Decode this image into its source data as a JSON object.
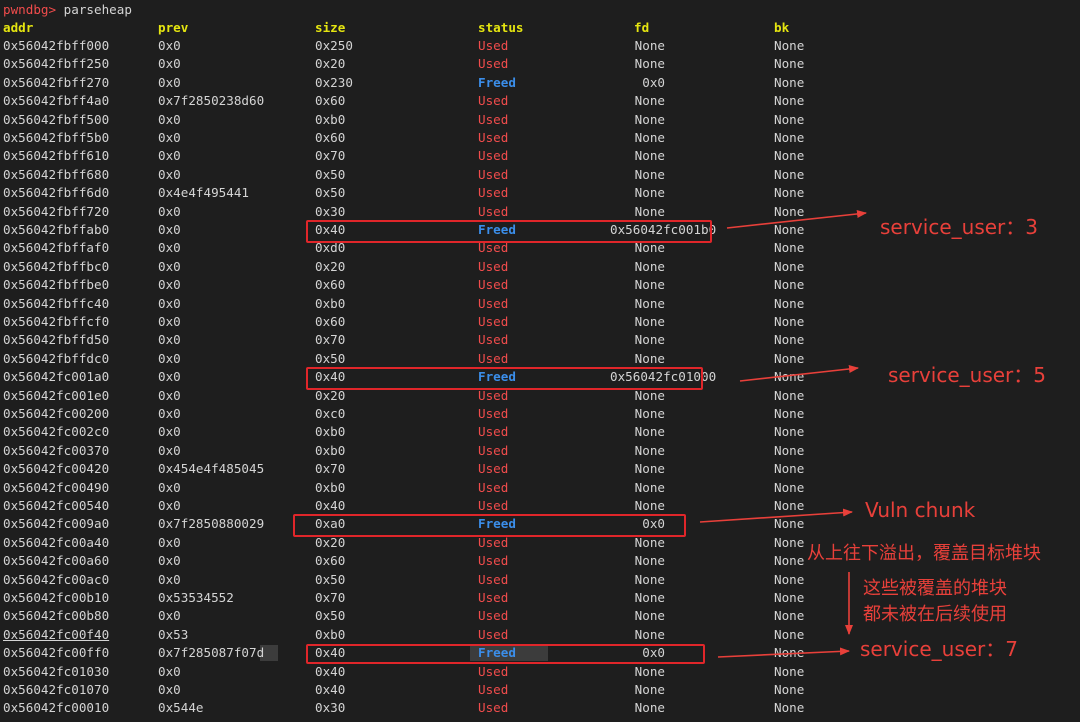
{
  "terminal": {
    "prompt": "pwndbg>",
    "command": "parseheap"
  },
  "table": {
    "headers": [
      "addr",
      "prev",
      "size",
      "status",
      "fd",
      "bk"
    ],
    "rows": [
      {
        "addr": "0x56042fbff000",
        "prev": "0x0",
        "size": "0x250",
        "status": "Used",
        "fd": "None",
        "bk": "None"
      },
      {
        "addr": "0x56042fbff250",
        "prev": "0x0",
        "size": "0x20",
        "status": "Used",
        "fd": "None",
        "bk": "None"
      },
      {
        "addr": "0x56042fbff270",
        "prev": "0x0",
        "size": "0x230",
        "status": "Freed",
        "fd": "0x0",
        "bk": "None"
      },
      {
        "addr": "0x56042fbff4a0",
        "prev": "0x7f2850238d60",
        "size": "0x60",
        "status": "Used",
        "fd": "None",
        "bk": "None"
      },
      {
        "addr": "0x56042fbff500",
        "prev": "0x0",
        "size": "0xb0",
        "status": "Used",
        "fd": "None",
        "bk": "None"
      },
      {
        "addr": "0x56042fbff5b0",
        "prev": "0x0",
        "size": "0x60",
        "status": "Used",
        "fd": "None",
        "bk": "None"
      },
      {
        "addr": "0x56042fbff610",
        "prev": "0x0",
        "size": "0x70",
        "status": "Used",
        "fd": "None",
        "bk": "None"
      },
      {
        "addr": "0x56042fbff680",
        "prev": "0x0",
        "size": "0x50",
        "status": "Used",
        "fd": "None",
        "bk": "None"
      },
      {
        "addr": "0x56042fbff6d0",
        "prev": "0x4e4f495441",
        "size": "0x50",
        "status": "Used",
        "fd": "None",
        "bk": "None"
      },
      {
        "addr": "0x56042fbff720",
        "prev": "0x0",
        "size": "0x30",
        "status": "Used",
        "fd": "None",
        "bk": "None"
      },
      {
        "addr": "0x56042fbffab0",
        "prev": "0x0",
        "size": "0x40",
        "status": "Freed",
        "fd": "0x56042fc001b0",
        "bk": "None"
      },
      {
        "addr": "0x56042fbffaf0",
        "prev": "0x0",
        "size": "0xd0",
        "status": "Used",
        "fd": "None",
        "bk": "None"
      },
      {
        "addr": "0x56042fbffbc0",
        "prev": "0x0",
        "size": "0x20",
        "status": "Used",
        "fd": "None",
        "bk": "None"
      },
      {
        "addr": "0x56042fbffbe0",
        "prev": "0x0",
        "size": "0x60",
        "status": "Used",
        "fd": "None",
        "bk": "None"
      },
      {
        "addr": "0x56042fbffc40",
        "prev": "0x0",
        "size": "0xb0",
        "status": "Used",
        "fd": "None",
        "bk": "None"
      },
      {
        "addr": "0x56042fbffcf0",
        "prev": "0x0",
        "size": "0x60",
        "status": "Used",
        "fd": "None",
        "bk": "None"
      },
      {
        "addr": "0x56042fbffd50",
        "prev": "0x0",
        "size": "0x70",
        "status": "Used",
        "fd": "None",
        "bk": "None"
      },
      {
        "addr": "0x56042fbffdc0",
        "prev": "0x0",
        "size": "0x50",
        "status": "Used",
        "fd": "None",
        "bk": "None"
      },
      {
        "addr": "0x56042fc001a0",
        "prev": "0x0",
        "size": "0x40",
        "status": "Freed",
        "fd": "0x56042fc01000",
        "bk": "None"
      },
      {
        "addr": "0x56042fc001e0",
        "prev": "0x0",
        "size": "0x20",
        "status": "Used",
        "fd": "None",
        "bk": "None"
      },
      {
        "addr": "0x56042fc00200",
        "prev": "0x0",
        "size": "0xc0",
        "status": "Used",
        "fd": "None",
        "bk": "None"
      },
      {
        "addr": "0x56042fc002c0",
        "prev": "0x0",
        "size": "0xb0",
        "status": "Used",
        "fd": "None",
        "bk": "None"
      },
      {
        "addr": "0x56042fc00370",
        "prev": "0x0",
        "size": "0xb0",
        "status": "Used",
        "fd": "None",
        "bk": "None"
      },
      {
        "addr": "0x56042fc00420",
        "prev": "0x454e4f485045",
        "size": "0x70",
        "status": "Used",
        "fd": "None",
        "bk": "None"
      },
      {
        "addr": "0x56042fc00490",
        "prev": "0x0",
        "size": "0xb0",
        "status": "Used",
        "fd": "None",
        "bk": "None"
      },
      {
        "addr": "0x56042fc00540",
        "prev": "0x0",
        "size": "0x40",
        "status": "Used",
        "fd": "None",
        "bk": "None"
      },
      {
        "addr": "0x56042fc009a0",
        "prev": "0x7f2850880029",
        "size": "0xa0",
        "status": "Freed",
        "fd": "0x0",
        "bk": "None"
      },
      {
        "addr": "0x56042fc00a40",
        "prev": "0x0",
        "size": "0x20",
        "status": "Used",
        "fd": "None",
        "bk": "None"
      },
      {
        "addr": "0x56042fc00a60",
        "prev": "0x0",
        "size": "0x60",
        "status": "Used",
        "fd": "None",
        "bk": "None"
      },
      {
        "addr": "0x56042fc00ac0",
        "prev": "0x0",
        "size": "0x50",
        "status": "Used",
        "fd": "None",
        "bk": "None"
      },
      {
        "addr": "0x56042fc00b10",
        "prev": "0x53534552",
        "size": "0x70",
        "status": "Used",
        "fd": "None",
        "bk": "None"
      },
      {
        "addr": "0x56042fc00b80",
        "prev": "0x0",
        "size": "0x50",
        "status": "Used",
        "fd": "None",
        "bk": "None"
      },
      {
        "addr": "0x56042fc00f40",
        "prev": "0x53",
        "size": "0xb0",
        "status": "Used",
        "fd": "None",
        "bk": "None"
      },
      {
        "addr": "0x56042fc00ff0",
        "prev": "0x7f285087f07d",
        "size": "0x40",
        "status": "Freed",
        "fd": "0x0",
        "bk": "None"
      },
      {
        "addr": "0x56042fc01030",
        "prev": "0x0",
        "size": "0x40",
        "status": "Used",
        "fd": "None",
        "bk": "None"
      },
      {
        "addr": "0x56042fc01070",
        "prev": "0x0",
        "size": "0x40",
        "status": "Used",
        "fd": "None",
        "bk": "None"
      },
      {
        "addr": "0x56042fc00010",
        "prev": "0x544e",
        "size": "0x30",
        "status": "Used",
        "fd": "None",
        "bk": "None"
      }
    ]
  },
  "annotations": {
    "service_user_3": "service_user：3",
    "service_user_5": "service_user：5",
    "vuln_chunk": "Vuln chunk",
    "overflow_note": "从上往下溢出，覆盖目标堆块",
    "unused_note_1": "这些被覆盖的堆块",
    "unused_note_2": "都未被在后续使用",
    "service_user_7": "service_user：7"
  },
  "colors": {
    "used": "#f14c4c",
    "freed": "#3b8eea",
    "header": "#e5e510",
    "annotation": "#e8403a"
  }
}
